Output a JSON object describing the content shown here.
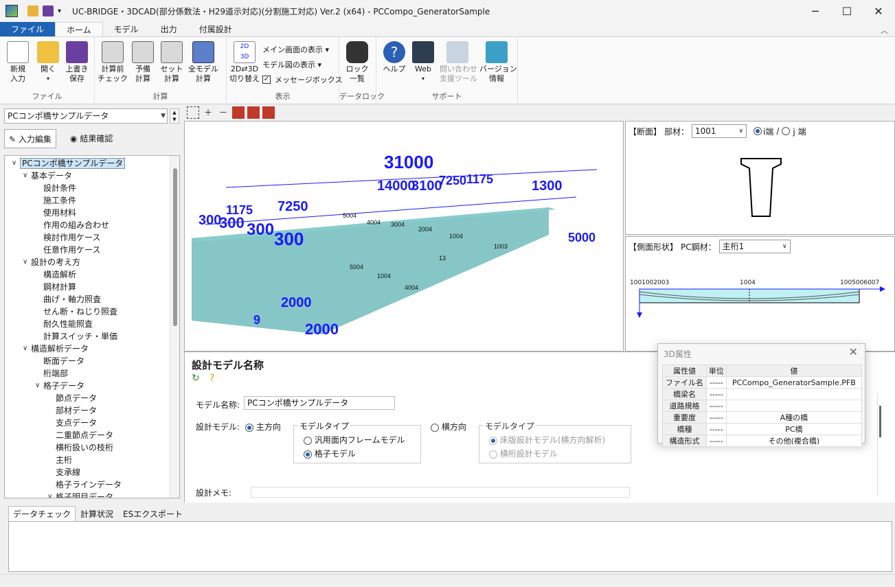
{
  "window": {
    "title": "UC-BRIDGE・3DCAD(部分係数法・H29道示対応)(分割施工対応) Ver.2 (x64) - PCCompo_GeneratorSample",
    "minimize": "─",
    "maximize": "☐",
    "close": "✕",
    "qa_more": "▾"
  },
  "tabs": [
    {
      "label": "ファイル"
    },
    {
      "label": "ホーム"
    },
    {
      "label": "モデル"
    },
    {
      "label": "出力"
    },
    {
      "label": "付属設計"
    }
  ],
  "ribbon": {
    "file_group": "ファイル",
    "new_l1": "新規",
    "new_l2": "入力",
    "open": "開く",
    "save_l1": "上書き",
    "save_l2": "保存",
    "calc_group": "計算",
    "pre_l1": "計算前",
    "pre_l2": "チェック",
    "pre2_l1": "予備",
    "pre2_l2": "計算",
    "set_l1": "セット",
    "set_l2": "計算",
    "all_l1": "全モデル",
    "all_l2": "計算",
    "display_group": "表示",
    "switch_l1": "2D⇄3D",
    "switch_l2": "切り替え",
    "main_view": "メイン画面の表示 ▾",
    "model_view": "モデル図の表示 ▾",
    "msgbox": "メッセージボックス",
    "lock_group": "データロック",
    "lock_l1": "ロック",
    "lock_l2": "一覧",
    "support_group": "サポート",
    "help": "ヘルプ",
    "web": "Web",
    "inq_l1": "問い合わせ",
    "inq_l2": "支援ツール",
    "ver_l1": "バージョン",
    "ver_l2": "情報",
    "icon_2d": "2D",
    "icon_3d": "3D"
  },
  "left": {
    "combo": "PCコンポ橋サンプルデータ",
    "btn_input": "入力編集",
    "btn_result": "結果確認",
    "tree": [
      {
        "label": "PCコンポ橋サンプルデータ",
        "level": 0,
        "exp": "∨"
      },
      {
        "label": "基本データ",
        "level": 1,
        "exp": "∨"
      },
      {
        "label": "設計条件",
        "level": 2
      },
      {
        "label": "施工条件",
        "level": 2
      },
      {
        "label": "使用材料",
        "level": 2
      },
      {
        "label": "作用の組み合わせ",
        "level": 2
      },
      {
        "label": "検討作用ケース",
        "level": 2
      },
      {
        "label": "任意作用ケース",
        "level": 2
      },
      {
        "label": "設計の考え方",
        "level": 1,
        "exp": "∨"
      },
      {
        "label": "構造解析",
        "level": 2
      },
      {
        "label": "鋼材計算",
        "level": 2
      },
      {
        "label": "曲げ・軸力照査",
        "level": 2
      },
      {
        "label": "せん断・ねじり照査",
        "level": 2
      },
      {
        "label": "耐久性能照査",
        "level": 2
      },
      {
        "label": "計算スイッチ・単価",
        "level": 2
      },
      {
        "label": "構造解析データ",
        "level": 1,
        "exp": "∨"
      },
      {
        "label": "断面データ",
        "level": 2
      },
      {
        "label": "桁端部",
        "level": 2
      },
      {
        "label": "格子データ",
        "level": 2,
        "exp": "∨"
      },
      {
        "label": "節点データ",
        "level": 3
      },
      {
        "label": "部材データ",
        "level": 3
      },
      {
        "label": "支点データ",
        "level": 3
      },
      {
        "label": "二重節点データ",
        "level": 3
      },
      {
        "label": "横桁扱いの枝桁",
        "level": 3
      },
      {
        "label": "主桁",
        "level": 3
      },
      {
        "label": "支承線",
        "level": 3
      },
      {
        "label": "格子ラインデータ",
        "level": 3
      },
      {
        "label": "格子明目データ",
        "level": 3,
        "exp": "∨"
      }
    ]
  },
  "view3d": {
    "dims": [
      "31000",
      "14000",
      "3100",
      "7250",
      "1175",
      "1300",
      "1175",
      "7250",
      "300",
      "300",
      "300",
      "300",
      "5000",
      "2000",
      "9",
      "2000"
    ],
    "labels": [
      "5004",
      "4004",
      "3004",
      "2004",
      "1004",
      "1003",
      "13",
      "1004",
      "5004",
      "4004"
    ]
  },
  "section": {
    "header": "【断面】",
    "member_label": "部材：",
    "member_value": "1001",
    "i_end": "i端",
    "slash": "/",
    "j_end": "j 端"
  },
  "side": {
    "header": "【側面形状】",
    "steel_label": "PC鋼材：",
    "steel_value": "主桁1",
    "left_label": "1001002003",
    "mid_label": "1004",
    "right_label": "1005006007"
  },
  "form": {
    "title": "設計モデル名称",
    "model_name_label": "モデル名称:",
    "model_name_value": "PCコンポ橋サンプルデータ",
    "design_model_label": "設計モデル:",
    "main_dir": "主方向",
    "model_type": "モデルタイプ",
    "opt1": "汎用面内フレームモデル",
    "opt2": "格子モデル",
    "cross_dir": "横方向",
    "model_type2": "モデルタイプ",
    "opt3": "床版設計モデル(横方向解析)",
    "opt4": "横桁設計モデル",
    "memo_label": "設計メモ:"
  },
  "props": {
    "title": "3D属性",
    "headers": [
      "属性値",
      "単位",
      "値"
    ],
    "rows": [
      [
        "ファイル名",
        "-----",
        "PCCompo_GeneratorSample.PFB"
      ],
      [
        "橋梁名",
        "-----",
        ""
      ],
      [
        "道路規格",
        "-----",
        ""
      ],
      [
        "重要度",
        "-----",
        "A種の橋"
      ],
      [
        "橋種",
        "-----",
        "PC橋"
      ],
      [
        "構造形式",
        "-----",
        "その他(複合橋)"
      ]
    ]
  },
  "bottom": {
    "tabs": [
      "データチェック",
      "計算状況",
      "ESエクスポート"
    ]
  },
  "colors": {
    "accent": "#1e63b5",
    "dim_blue": "#1a1aff",
    "girder": "#5fb3b3"
  }
}
